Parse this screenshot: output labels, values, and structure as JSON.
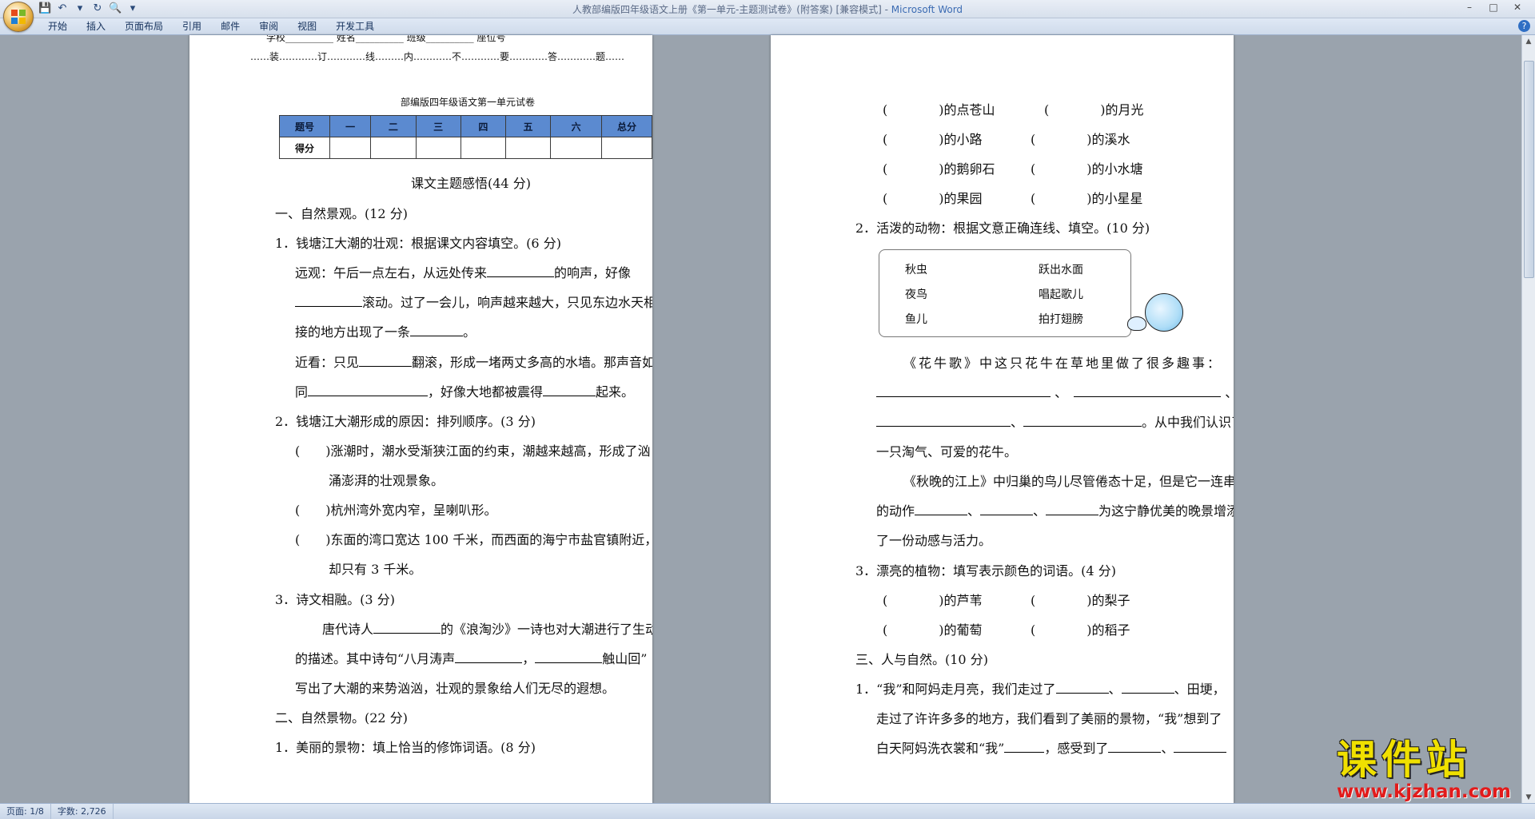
{
  "window": {
    "title": "人教部编版四年级语文上册《第一单元-主题测试卷》(附答案) [兼容模式] - ",
    "app_name": "Microsoft Word",
    "controls": [
      "–",
      "□",
      "✕"
    ]
  },
  "quick_access": [
    "💾",
    "↶",
    "▾",
    "↻",
    "🔍",
    "▾"
  ],
  "ribbon": {
    "tabs": [
      "开始",
      "插入",
      "页面布局",
      "引用",
      "邮件",
      "审阅",
      "视图",
      "开发工具"
    ],
    "help": "?"
  },
  "status": {
    "page": "页面: 1/8",
    "words": "字数: 2,726"
  },
  "left_page": {
    "header_fields": "学校__________    姓名__________    班级__________    座位号",
    "seal_line": "……装…………订…………线………内…………不…………要…………答…………题……",
    "exam_title": "部编版四年级语文第一单元试卷",
    "score_table": {
      "headers": [
        "题号",
        "一",
        "二",
        "三",
        "四",
        "五",
        "六",
        "总分"
      ],
      "row_label": "得分"
    },
    "section_title": "课文主题感悟(44 分)",
    "s1": "一、自然景观。(12 分)",
    "q1": "1．钱塘江大潮的壮观：根据课文内容填空。(6 分)",
    "q1_l1a": "远观：午后一点左右，从远处传来",
    "q1_l1b": "的响声，好像",
    "q1_l2": "滚动。过了一会儿，响声越来越大，只见东边水天相",
    "q1_l3a": "接的地方出现了一条",
    "q1_l3b": "。",
    "q1_l4a": "近看：只见",
    "q1_l4b": "翻滚，形成一堵两丈多高的水墙。那声音如",
    "q1_l5a": "同",
    "q1_l5b": "，好像大地都被震得",
    "q1_l5c": "起来。",
    "q2": "2．钱塘江大潮形成的原因：排列顺序。(3 分)",
    "q2_a1": "(　　)涨潮时，潮水受渐狭江面的约束，潮越来越高，形成了汹",
    "q2_a2": "涌澎湃的壮观景象。",
    "q2_b": "(　　)杭州湾外宽内窄，呈喇叭形。",
    "q2_c1": "(　　)东面的湾口宽达 100 千米，而西面的海宁市盐官镇附近，",
    "q2_c2": "却只有 3 千米。",
    "q3": "3．诗文相融。(3 分)",
    "q3_l1a": "唐代诗人",
    "q3_l1b": "的《浪淘沙》一诗也对大潮进行了生动",
    "q3_l2a": "的描述。其中诗句“八月涛声",
    "q3_l2b": "，",
    "q3_l2c": "触山回”",
    "q3_l3": "写出了大潮的来势汹汹，壮观的景象给人们无尽的遐想。",
    "s2": "二、自然景物。(22 分)",
    "q4": "1．美丽的景物：填上恰当的修饰词语。(8 分)"
  },
  "right_page": {
    "r1a": "(　　　　)的点苍山",
    "r1b": "(　　　　)的月光",
    "r2a": "(　　　　)的小路",
    "r2b": "(　　　　)的溪水",
    "r3a": "(　　　　)的鹅卵石",
    "r3b": "(　　　　)的小水塘",
    "r4a": "(　　　　)的果园",
    "r4b": "(　　　　)的小星星",
    "q2": "2．活泼的动物：根据文意正确连线、填空。(10 分)",
    "box_left": [
      "秋虫",
      "夜鸟",
      "鱼儿"
    ],
    "box_right": [
      "跃出水面",
      "唱起歌儿",
      "拍打翅膀"
    ],
    "p1": "《花牛歌》中这只花牛在草地里做了很多趣事：",
    "p2_sep1": "、",
    "p2_sep2": "、",
    "p3_sep": "、",
    "p3_tail": "。从中我们认识了",
    "p4": "一只淘气、可爱的花牛。",
    "p5": "《秋晚的江上》中归巢的鸟儿尽管倦态十足，但是它一连串",
    "p6a": "的动作",
    "p6_sep1": "、",
    "p6_sep2": "、",
    "p6b": "为这宁静优美的晚景增添",
    "p7": "了一份动感与活力。",
    "q3": "3．漂亮的植物：填写表示颜色的词语。(4 分)",
    "c1a": "(　　　　)的芦苇",
    "c1b": "(　　　　)的梨子",
    "c2a": "(　　　　)的葡萄",
    "c2b": "(　　　　)的稻子",
    "s3": "三、人与自然。(10 分)",
    "t1a": "1．“我”和阿妈走月亮，我们走过了",
    "t1_sep1": "、",
    "t1_sep2": "、田埂，",
    "t2": "走过了许许多多的地方，我们看到了美丽的景物，“我”想到了",
    "t3a": "白天阿妈洗衣裳和“我”",
    "t3b": "，感受到了",
    "t3_sep": "、"
  },
  "watermark": {
    "cn": "课件站",
    "url": "www.kjzhan.com"
  }
}
